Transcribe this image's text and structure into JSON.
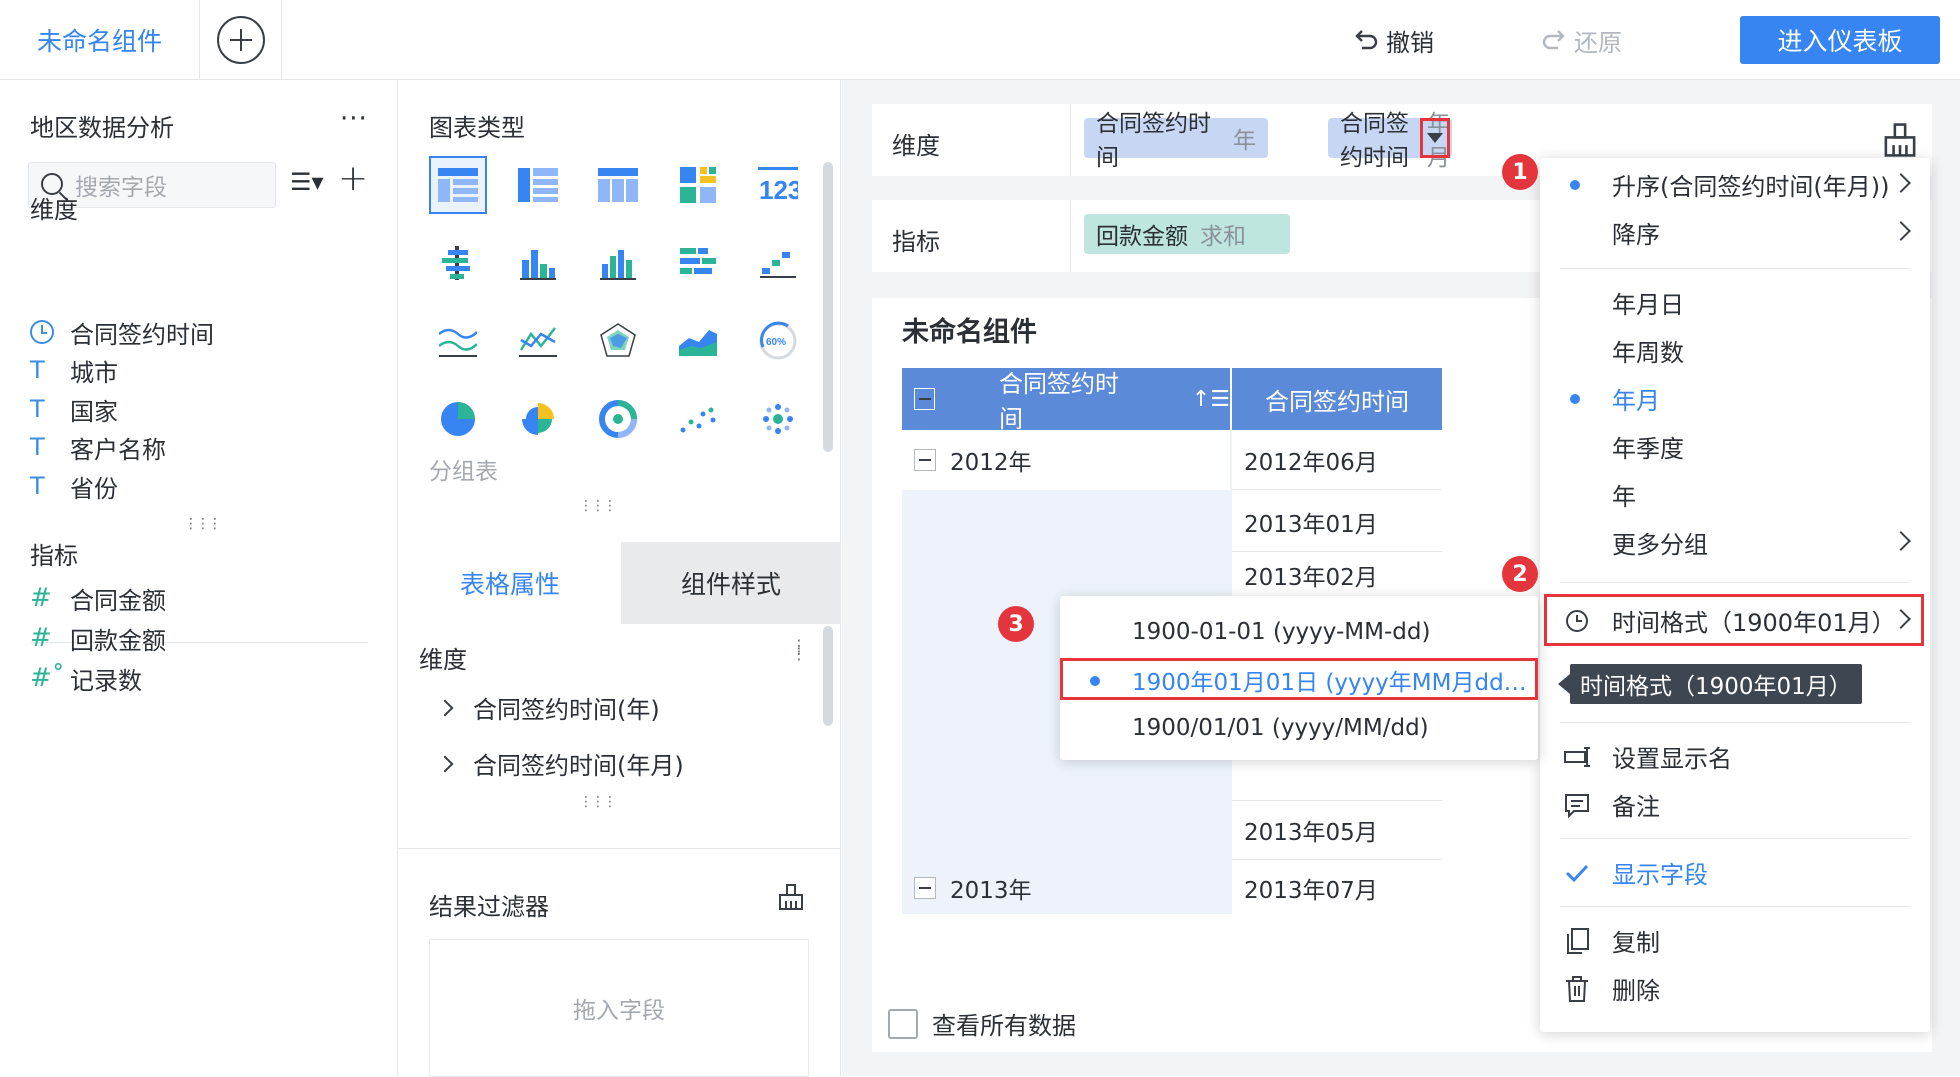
{
  "header": {
    "tab_label": "未命名组件",
    "undo_label": "撤销",
    "redo_label": "还原",
    "dashboard_button": "进入仪表板"
  },
  "left": {
    "dataset_title": "地区数据分析",
    "more": "···",
    "search_placeholder": "搜索字段",
    "dimension_label": "维度",
    "dimensions": [
      "合同签约时间",
      "城市",
      "国家",
      "客户名称",
      "省份"
    ],
    "measure_label": "指标",
    "measures": [
      "合同金额",
      "回款金额",
      "记录数"
    ]
  },
  "middle": {
    "chart_type_title": "图表类型",
    "group_label": "分组表",
    "tab_table": "表格属性",
    "tab_style": "组件样式",
    "dim_title": "维度",
    "dim_rows": [
      "合同签约时间(年)",
      "合同签约时间(年月)"
    ],
    "filter_title": "结果过滤器",
    "drop_hint": "拖入字段"
  },
  "config": {
    "dimension_label": "维度",
    "measure_label": "指标",
    "pill1_name": "合同签约时间",
    "pill1_sub": "年",
    "pill2_name": "合同签约时间",
    "pill2_sub": "年月",
    "pill3_name": "回款金额",
    "pill3_sub": "求和"
  },
  "canvas": {
    "title": "未命名组件",
    "col1": "合同签约时间",
    "col2": "合同签约时间",
    "y2012": "2012年",
    "y2013": "2013年",
    "r1": "2012年06月",
    "r2": "2013年01月",
    "r3": "2013年02月",
    "r4": "2013年05月",
    "r5": "2013年07月",
    "view_all": "查看所有数据"
  },
  "menu": {
    "asc": "升序(合同签约时间(年月))",
    "desc": "降序",
    "ymd": "年月日",
    "yweek": "年周数",
    "ym": "年月",
    "yq": "年季度",
    "y": "年",
    "more_group": "更多分组",
    "time_format": "时间格式（1900年01月）",
    "tooltip": "时间格式（1900年01月）",
    "set_name": "设置显示名",
    "note": "备注",
    "show_field": "显示字段",
    "copy": "复制",
    "delete": "删除"
  },
  "submenu": {
    "opt1": "1900-01-01 (yyyy-MM-dd)",
    "opt2": "1900年01月01日 (yyyy年MM月dd…",
    "opt3": "1900/01/01 (yyyy/MM/dd)"
  },
  "badges": [
    "1",
    "2",
    "3"
  ],
  "colors": {
    "accent": "#3685f2",
    "highlight": "#e5353c",
    "header_blue": "#5b8bd8"
  }
}
